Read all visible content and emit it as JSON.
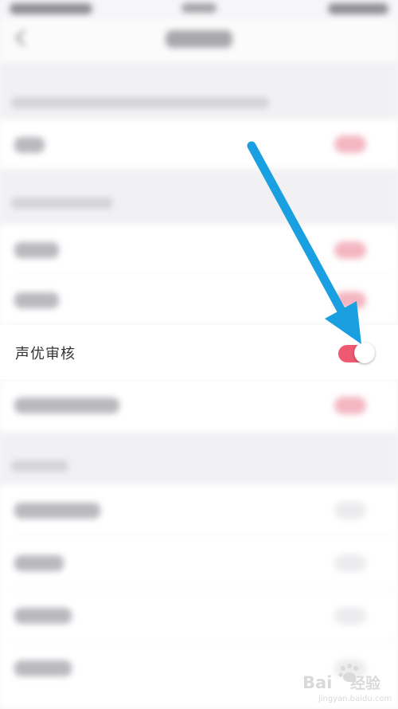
{
  "focus_setting": {
    "label": "声优审核",
    "enabled": true
  },
  "colors": {
    "accent": "#ee5a6f",
    "arrow": "#1a9fe0",
    "page_bg": "#f6f6f8"
  },
  "icons": {
    "back": "back-arrow-icon",
    "pointer": "pointer-arrow-icon"
  },
  "watermark": {
    "brand": "Baidu",
    "product": "经验",
    "site": "jingyan.baidu.com"
  }
}
